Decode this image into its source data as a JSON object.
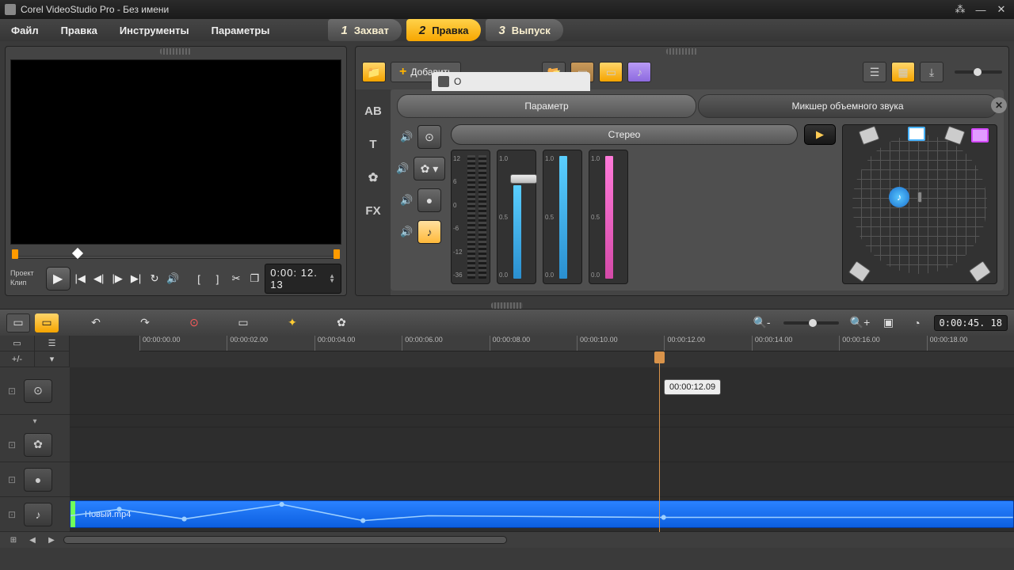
{
  "window": {
    "title": "Corel VideoStudio Pro - Без имени"
  },
  "menu": {
    "file": "Файл",
    "edit": "Правка",
    "tools": "Инструменты",
    "options": "Параметры"
  },
  "steps": [
    {
      "num": "1",
      "label": "Захват",
      "active": false
    },
    {
      "num": "2",
      "label": "Правка",
      "active": true
    },
    {
      "num": "3",
      "label": "Выпуск",
      "active": false
    }
  ],
  "preview": {
    "mode_top": "Проект",
    "mode_bottom": "Клип",
    "timecode": "0:00: 12. 13",
    "bracket_open": "[",
    "bracket_close": "]"
  },
  "library": {
    "add_label": "Добавить",
    "popup_label": "О",
    "tabs": {
      "param": "Параметр",
      "mixer": "Микшер объемного звука"
    },
    "side": {
      "ab": "AB",
      "t": "T",
      "fx": "FX"
    },
    "stereo": "Стерео",
    "vu_db": {
      "t12": "12",
      "t6": "6",
      "t0": "0",
      "tm6": "-6",
      "tm12": "-12",
      "tm36": "-36"
    },
    "vu_lin": {
      "t10": "1.0",
      "t05": "0.5",
      "t00": "0.0"
    }
  },
  "tl_toolbar": {
    "timecode": "0:00:45. 18"
  },
  "ruler": {
    "ticks": [
      "00:00:00.00",
      "00:00:02.00",
      "00:00:04.00",
      "00:00:06.00",
      "00:00:08.00",
      "00:00:10.00",
      "00:00:12.00",
      "00:00:14.00",
      "00:00:16.00",
      "00:00:18.00"
    ]
  },
  "playhead": {
    "tip": "00:00:12.09"
  },
  "tracks": {
    "toggle_label": "+/-",
    "audio_clip_name": "Новый.mp4"
  }
}
